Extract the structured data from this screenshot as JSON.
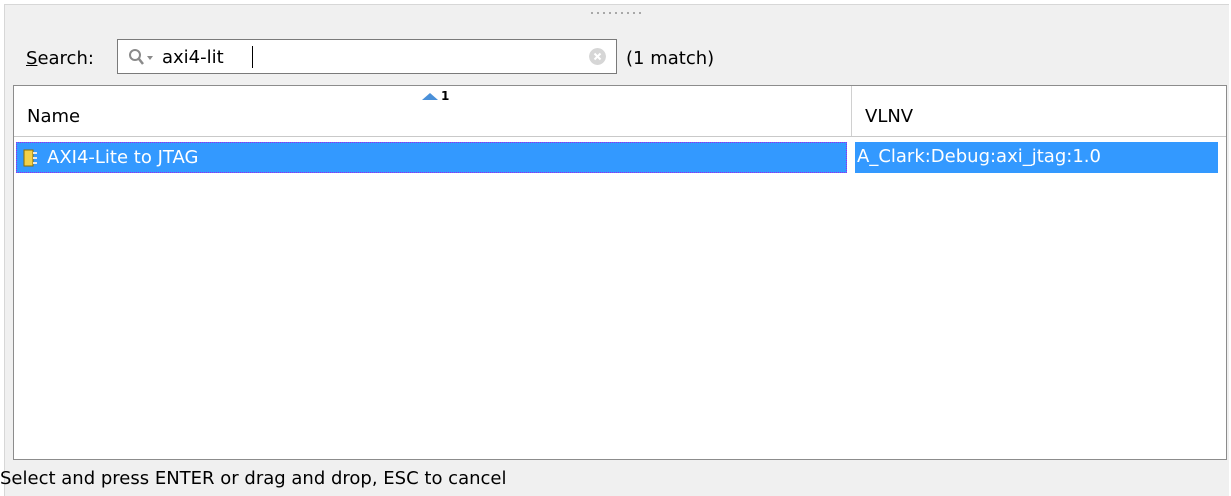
{
  "search": {
    "label_underline": "S",
    "label_rest": "earch:",
    "value": "axi4-lit",
    "match_count": "(1 match)"
  },
  "table": {
    "columns": [
      {
        "label": "Name"
      },
      {
        "label": "VLNV"
      }
    ],
    "sort_index": "1",
    "sort_direction": "ascending",
    "rows": [
      {
        "name": "AXI4-Lite to JTAG",
        "vlnv": "A_Clark:Debug:axi_jtag:1.0",
        "selected": true
      }
    ]
  },
  "status": {
    "text": "Select and press ENTER or drag and drop, ESC to cancel"
  },
  "colors": {
    "selection": "#3399ff",
    "focus_border": "#a020f0"
  },
  "icons": {
    "search": "search-icon",
    "clear": "clear-icon",
    "ip": "ip-block-icon"
  }
}
